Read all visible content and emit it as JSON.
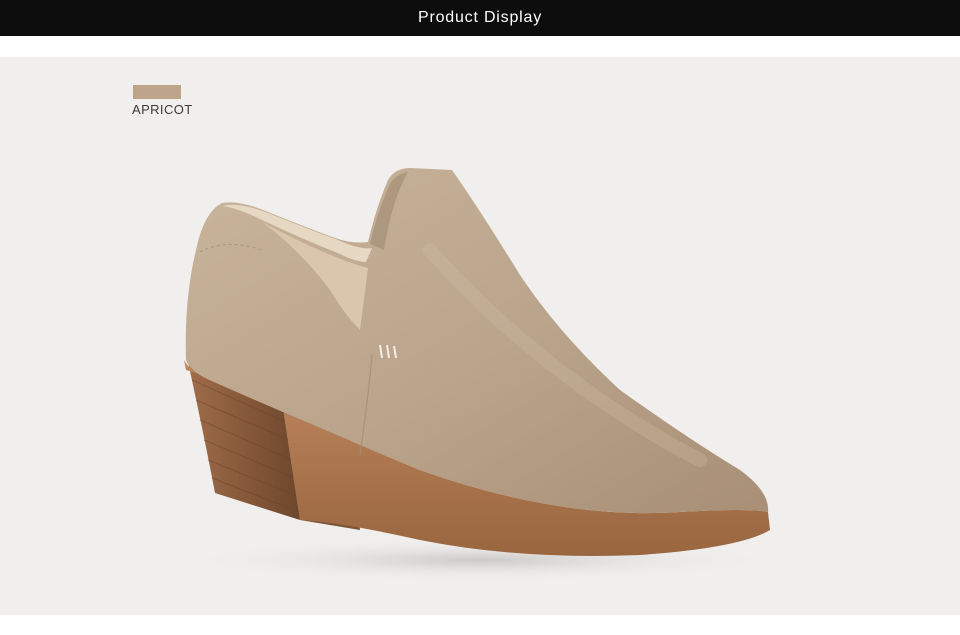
{
  "header": {
    "title": "Product Display"
  },
  "product": {
    "color_name": "APRICOT",
    "color_swatch": "#bda48a",
    "photo_description_icon": "suede-ankle-bootie-photo"
  },
  "colors": {
    "header_bg": "#0d0d0d",
    "header_text": "#ffffff",
    "photo_bg": "#f0efee",
    "suede": "#bba68e",
    "sole": "#b07a52",
    "heel": "#8c6040"
  }
}
